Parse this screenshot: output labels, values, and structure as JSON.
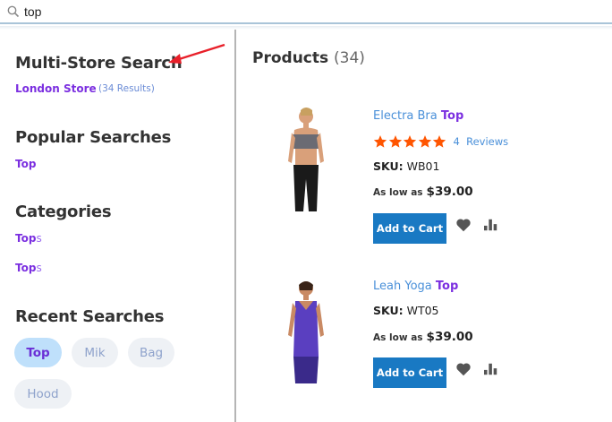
{
  "search": {
    "value": "top"
  },
  "left": {
    "multi_store_heading": "Multi-Store Search",
    "store_name": "London Store",
    "store_results": "(34 Results)",
    "popular_heading": "Popular Searches",
    "popular_item": "Top",
    "categories_heading": "Categories",
    "categories": [
      {
        "match": "Top",
        "rest": "s"
      },
      {
        "match": "Top",
        "rest": "s"
      }
    ],
    "recent_heading": "Recent Searches",
    "recent": [
      "Top",
      "Mik",
      "Bag",
      "Hood"
    ]
  },
  "products": {
    "title": "Products",
    "count": "(34)",
    "items": [
      {
        "name_prefix": "Electra Bra ",
        "name_match": "Top",
        "rating_stars": 5,
        "reviews": "4  Reviews",
        "sku_label": "SKU:",
        "sku_value": "WB01",
        "price_label": "As low as",
        "price": "$39.00",
        "cart_label": "Add to Cart",
        "image_color": "#6b6b73"
      },
      {
        "name_prefix": "Leah Yoga ",
        "name_match": "Top",
        "sku_label": "SKU:",
        "sku_value": "WT05",
        "price_label": "As low as",
        "price": "$39.00",
        "cart_label": "Add to Cart",
        "image_color": "#5a3fc0"
      }
    ]
  },
  "colors": {
    "accent": "#7b2fe0",
    "link": "#4a90d9",
    "button": "#1979c3",
    "star": "#ff5501",
    "annotation_arrow": "#e8202a"
  }
}
